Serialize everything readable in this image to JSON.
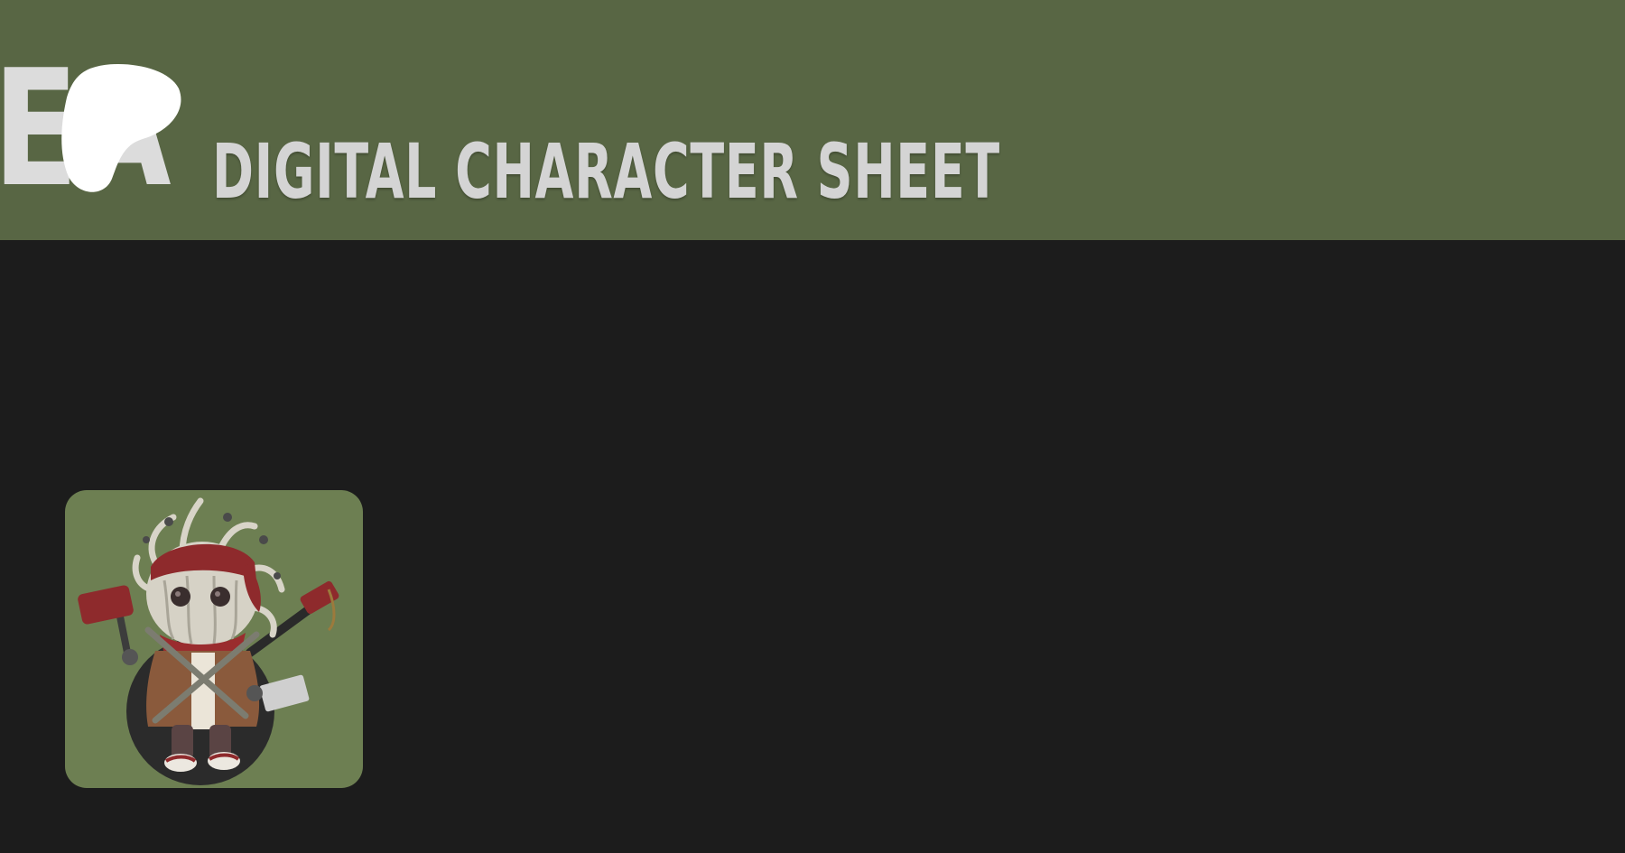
{
  "header": {
    "logo_text": "EA",
    "title": "DIGITAL CHARACTER SHEET",
    "background_color": "#586644",
    "text_color": "#d4d4d4"
  },
  "main": {
    "background_color": "#1c1c1c"
  },
  "character": {
    "portrait_icon": "character-portrait-icon",
    "portrait_background": "#6d7f52"
  }
}
